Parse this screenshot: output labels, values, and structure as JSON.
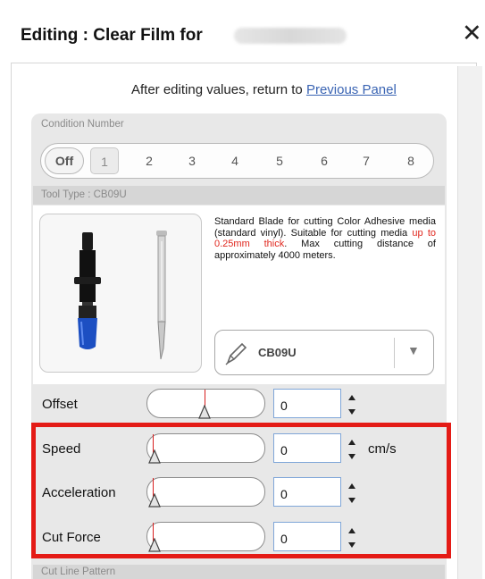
{
  "window": {
    "title": "Editing : Clear Film for",
    "close_symbol": "✕"
  },
  "header": {
    "instruction": "After editing values, return to ",
    "link": "Previous Panel"
  },
  "condition": {
    "section_label": "Condition Number",
    "off_label": "Off",
    "numbers": [
      "1",
      "2",
      "3",
      "4",
      "5",
      "6",
      "7",
      "8"
    ],
    "selected": "1"
  },
  "tool": {
    "section_label": "Tool Type : CB09U",
    "desc_pre": "Standard Blade for cutting Color Adhesive media (standard vinyl). Suitable for cutting media ",
    "desc_warn": "up to 0.25mm thick",
    "desc_post": ". Max cutting distance of approximately 4000 meters.",
    "blade_value": "CB09U",
    "dropdown_arrow": "▼",
    "pen_icon": "pen-icon",
    "warn_color": "#e0261d"
  },
  "params": [
    {
      "label": "Offset",
      "value": "0",
      "unit": "",
      "level": 0.5
    },
    {
      "label": "Speed",
      "value": "0",
      "unit": "cm/s",
      "level": 0.0
    },
    {
      "label": "Acceleration",
      "value": "0",
      "unit": "",
      "level": 0.0
    },
    {
      "label": "Cut Force",
      "value": "0",
      "unit": "",
      "level": 0.0
    }
  ],
  "cut_line": {
    "section_label": "Cut Line Pattern"
  },
  "highlight_color": "#e41b16"
}
